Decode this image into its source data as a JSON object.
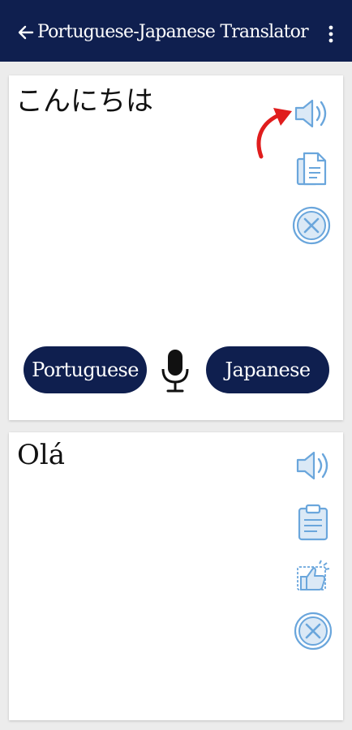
{
  "header": {
    "title": "Portuguese-Japanese Translator",
    "back_icon": "arrow-left-icon",
    "menu_icon": "vertical-dots-icon"
  },
  "source": {
    "text": "こんにちは",
    "language_button": "Portuguese",
    "actions": [
      "speaker-icon",
      "copy-icon",
      "clear-icon"
    ]
  },
  "target": {
    "text": "Olá",
    "language_button": "Japanese",
    "actions": [
      "speaker-icon",
      "clipboard-icon",
      "like-icon",
      "clear-icon"
    ]
  },
  "colors": {
    "brand_navy": "#0f1f4f",
    "icon_blue": "#6aa6dc",
    "accent_red": "#e01d1d",
    "background": "#ececec"
  }
}
